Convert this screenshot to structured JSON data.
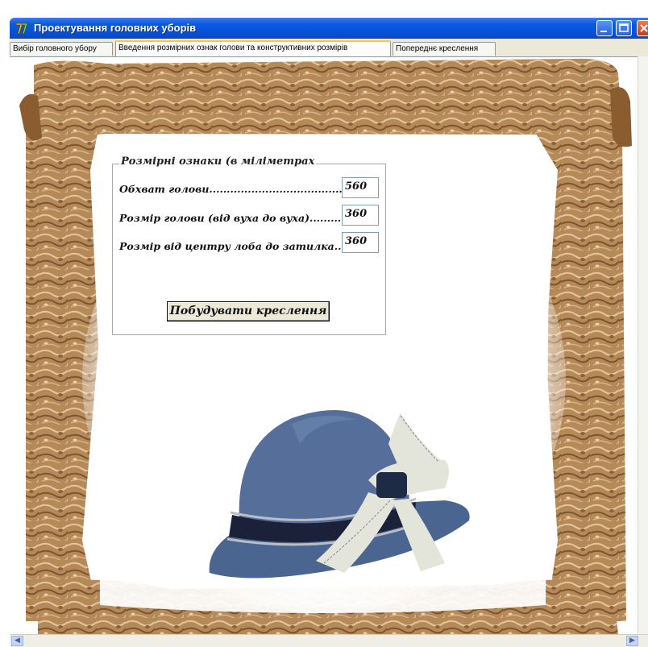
{
  "window": {
    "title": "Проектування головних уборів",
    "icon": "app-icon"
  },
  "tabs": [
    {
      "label": "Вибір головного убору",
      "active": false
    },
    {
      "label": "Введення розмірних ознак голови та конструктивних розмірів",
      "active": true
    },
    {
      "label": "Попереднє креслення",
      "active": false
    }
  ],
  "form": {
    "group_caption": "Розмірні ознаки (в міліметрах",
    "rows": [
      {
        "label": "Обхват голови.......................................",
        "value": "560"
      },
      {
        "label": "Розмір голови (від вуха до вуха).........",
        "value": "360"
      },
      {
        "label": "Розмір від центру лоба до затилка...",
        "value": "360"
      }
    ],
    "build_button": "Побудувати креслення"
  },
  "colors": {
    "title_bar": "#0652d8",
    "parchment": "#b98d5c",
    "hat": "#4a6590",
    "bow": "#e3e4da",
    "band": "#1a2138"
  }
}
